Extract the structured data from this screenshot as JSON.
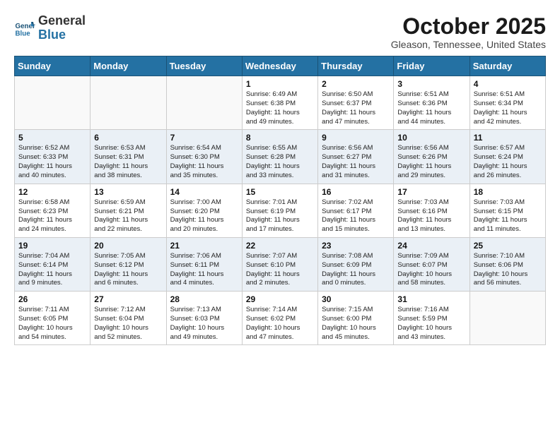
{
  "header": {
    "logo_line1": "General",
    "logo_line2": "Blue",
    "month_title": "October 2025",
    "location": "Gleason, Tennessee, United States"
  },
  "days_of_week": [
    "Sunday",
    "Monday",
    "Tuesday",
    "Wednesday",
    "Thursday",
    "Friday",
    "Saturday"
  ],
  "weeks": [
    [
      {
        "day": "",
        "info": ""
      },
      {
        "day": "",
        "info": ""
      },
      {
        "day": "",
        "info": ""
      },
      {
        "day": "1",
        "info": "Sunrise: 6:49 AM\nSunset: 6:38 PM\nDaylight: 11 hours\nand 49 minutes."
      },
      {
        "day": "2",
        "info": "Sunrise: 6:50 AM\nSunset: 6:37 PM\nDaylight: 11 hours\nand 47 minutes."
      },
      {
        "day": "3",
        "info": "Sunrise: 6:51 AM\nSunset: 6:36 PM\nDaylight: 11 hours\nand 44 minutes."
      },
      {
        "day": "4",
        "info": "Sunrise: 6:51 AM\nSunset: 6:34 PM\nDaylight: 11 hours\nand 42 minutes."
      }
    ],
    [
      {
        "day": "5",
        "info": "Sunrise: 6:52 AM\nSunset: 6:33 PM\nDaylight: 11 hours\nand 40 minutes."
      },
      {
        "day": "6",
        "info": "Sunrise: 6:53 AM\nSunset: 6:31 PM\nDaylight: 11 hours\nand 38 minutes."
      },
      {
        "day": "7",
        "info": "Sunrise: 6:54 AM\nSunset: 6:30 PM\nDaylight: 11 hours\nand 35 minutes."
      },
      {
        "day": "8",
        "info": "Sunrise: 6:55 AM\nSunset: 6:28 PM\nDaylight: 11 hours\nand 33 minutes."
      },
      {
        "day": "9",
        "info": "Sunrise: 6:56 AM\nSunset: 6:27 PM\nDaylight: 11 hours\nand 31 minutes."
      },
      {
        "day": "10",
        "info": "Sunrise: 6:56 AM\nSunset: 6:26 PM\nDaylight: 11 hours\nand 29 minutes."
      },
      {
        "day": "11",
        "info": "Sunrise: 6:57 AM\nSunset: 6:24 PM\nDaylight: 11 hours\nand 26 minutes."
      }
    ],
    [
      {
        "day": "12",
        "info": "Sunrise: 6:58 AM\nSunset: 6:23 PM\nDaylight: 11 hours\nand 24 minutes."
      },
      {
        "day": "13",
        "info": "Sunrise: 6:59 AM\nSunset: 6:21 PM\nDaylight: 11 hours\nand 22 minutes."
      },
      {
        "day": "14",
        "info": "Sunrise: 7:00 AM\nSunset: 6:20 PM\nDaylight: 11 hours\nand 20 minutes."
      },
      {
        "day": "15",
        "info": "Sunrise: 7:01 AM\nSunset: 6:19 PM\nDaylight: 11 hours\nand 17 minutes."
      },
      {
        "day": "16",
        "info": "Sunrise: 7:02 AM\nSunset: 6:17 PM\nDaylight: 11 hours\nand 15 minutes."
      },
      {
        "day": "17",
        "info": "Sunrise: 7:03 AM\nSunset: 6:16 PM\nDaylight: 11 hours\nand 13 minutes."
      },
      {
        "day": "18",
        "info": "Sunrise: 7:03 AM\nSunset: 6:15 PM\nDaylight: 11 hours\nand 11 minutes."
      }
    ],
    [
      {
        "day": "19",
        "info": "Sunrise: 7:04 AM\nSunset: 6:14 PM\nDaylight: 11 hours\nand 9 minutes."
      },
      {
        "day": "20",
        "info": "Sunrise: 7:05 AM\nSunset: 6:12 PM\nDaylight: 11 hours\nand 6 minutes."
      },
      {
        "day": "21",
        "info": "Sunrise: 7:06 AM\nSunset: 6:11 PM\nDaylight: 11 hours\nand 4 minutes."
      },
      {
        "day": "22",
        "info": "Sunrise: 7:07 AM\nSunset: 6:10 PM\nDaylight: 11 hours\nand 2 minutes."
      },
      {
        "day": "23",
        "info": "Sunrise: 7:08 AM\nSunset: 6:09 PM\nDaylight: 11 hours\nand 0 minutes."
      },
      {
        "day": "24",
        "info": "Sunrise: 7:09 AM\nSunset: 6:07 PM\nDaylight: 10 hours\nand 58 minutes."
      },
      {
        "day": "25",
        "info": "Sunrise: 7:10 AM\nSunset: 6:06 PM\nDaylight: 10 hours\nand 56 minutes."
      }
    ],
    [
      {
        "day": "26",
        "info": "Sunrise: 7:11 AM\nSunset: 6:05 PM\nDaylight: 10 hours\nand 54 minutes."
      },
      {
        "day": "27",
        "info": "Sunrise: 7:12 AM\nSunset: 6:04 PM\nDaylight: 10 hours\nand 52 minutes."
      },
      {
        "day": "28",
        "info": "Sunrise: 7:13 AM\nSunset: 6:03 PM\nDaylight: 10 hours\nand 49 minutes."
      },
      {
        "day": "29",
        "info": "Sunrise: 7:14 AM\nSunset: 6:02 PM\nDaylight: 10 hours\nand 47 minutes."
      },
      {
        "day": "30",
        "info": "Sunrise: 7:15 AM\nSunset: 6:00 PM\nDaylight: 10 hours\nand 45 minutes."
      },
      {
        "day": "31",
        "info": "Sunrise: 7:16 AM\nSunset: 5:59 PM\nDaylight: 10 hours\nand 43 minutes."
      },
      {
        "day": "",
        "info": ""
      }
    ]
  ]
}
